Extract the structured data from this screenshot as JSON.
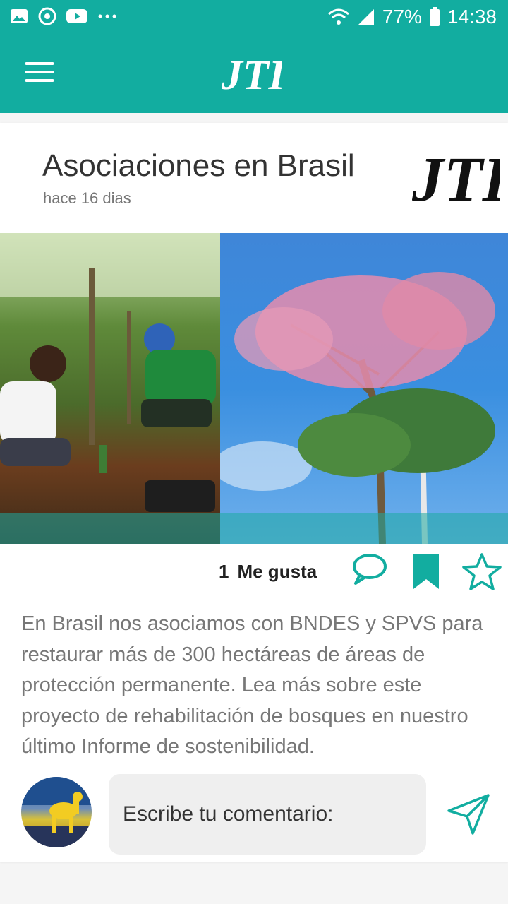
{
  "statusbar": {
    "battery": "77%",
    "time": "14:38",
    "icons": [
      "image-icon",
      "app-icon",
      "youtube-icon",
      "more-dots-icon",
      "wifi-icon",
      "signal-icon",
      "battery-icon"
    ]
  },
  "appbar": {
    "logo": "JTI",
    "menu_icon": "hamburger-menu-icon"
  },
  "post": {
    "title": "Asociaciones en Brasil",
    "time": "hace 16 dias",
    "logo": "JTI",
    "likes_count": "1",
    "likes_label": "Me gusta",
    "body": "En Brasil nos asociamos con BNDES y SPVS para restaurar más de 300 hectáreas de áreas de protección permanente. Lea más sobre este proyecto de rehabilitación de bosques en nuestro último Informe de sostenibilidad."
  },
  "comment": {
    "placeholder": "Escribe tu comentario:"
  },
  "colors": {
    "brand": "#12ada0",
    "text_dark": "#333333",
    "text_muted": "#777777"
  }
}
